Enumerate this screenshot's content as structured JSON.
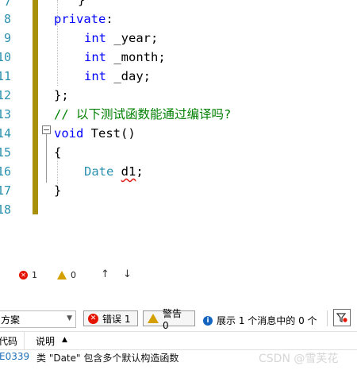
{
  "editor": {
    "line_numbers": [
      "7",
      "8",
      "9",
      "10",
      "11",
      "12",
      "13",
      "14",
      "15",
      "16",
      "17",
      "18"
    ],
    "lines": {
      "brace_close_top": "}",
      "private_kw": "private",
      "colon": ":",
      "int1": "int",
      "year": " _year;",
      "int2": "int",
      "month": " _month;",
      "int3": "int",
      "day": " _day;",
      "class_end": "};",
      "comment": "// 以下测试函数能通过编译吗?",
      "void_kw": "void",
      "fn_name": " Test()",
      "open_brace": "{",
      "date_type": "Date",
      "date_space": " ",
      "d1": "d1",
      "semi": ";",
      "close_brace": "}"
    }
  },
  "toolbar": {
    "error_count": "1",
    "warning_count": "0",
    "up_arrow": "↑",
    "down_arrow": "↓"
  },
  "filter": {
    "scope_value": "方案",
    "errors_label": "错误 1",
    "warnings_label": "警告 0",
    "info_label": "展示 1 个消息中的 0 个"
  },
  "list": {
    "col_code": "代码",
    "col_desc": "说明",
    "sort_indicator": "▲",
    "rows": [
      {
        "code": "E0339",
        "description": "类 \"Date\" 包含多个默认构造函数"
      }
    ]
  },
  "watermark": "CSDN @雪芙花",
  "colors": {
    "error": "#e51400",
    "warning": "#d4a000",
    "info": "#1565c0",
    "keyword": "#0000ff",
    "type": "#2b91af",
    "comment": "#008000",
    "change_bar": "#a8900b"
  }
}
